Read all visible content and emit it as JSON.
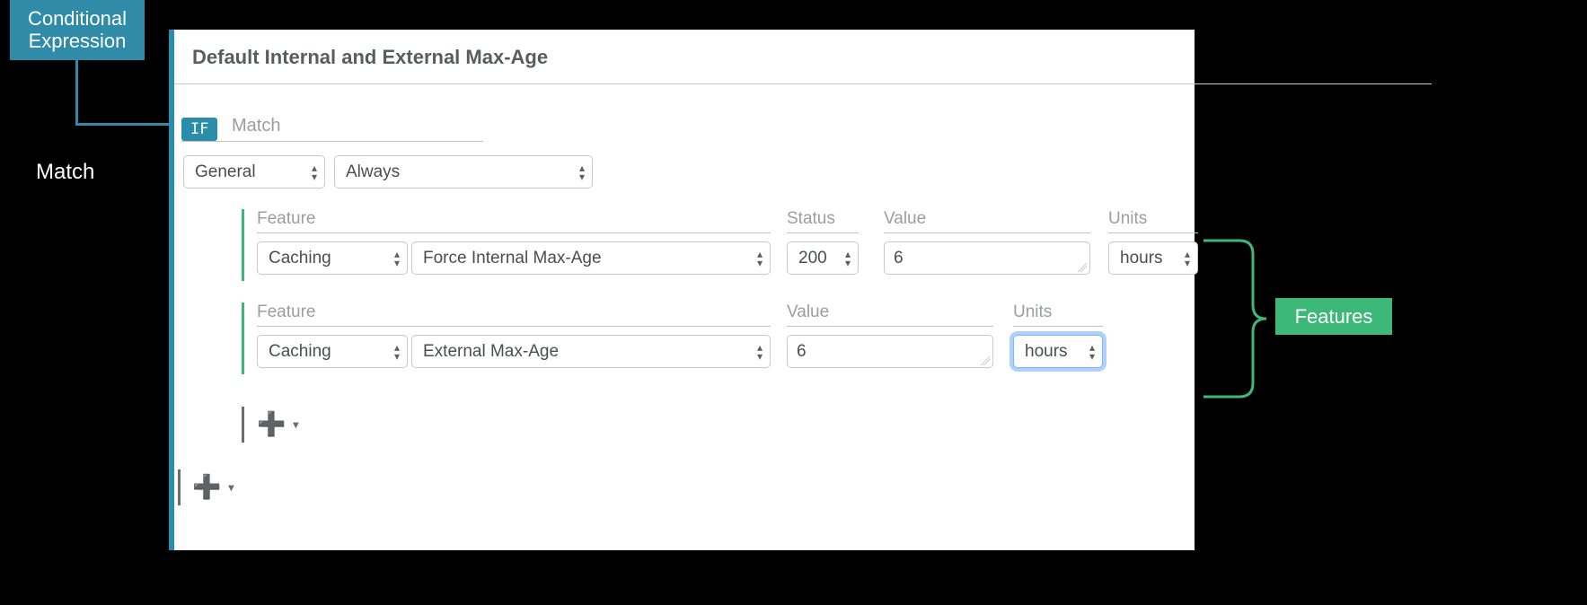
{
  "title": "Default Internal and External Max-Age",
  "if_badge": "IF",
  "match_header_label": "Match",
  "match": {
    "category": "General",
    "condition": "Always"
  },
  "features": [
    {
      "labels": {
        "feature": "Feature",
        "status": "Status",
        "value": "Value",
        "units": "Units"
      },
      "category": "Caching",
      "name": "Force Internal Max-Age",
      "status": "200",
      "value": "6",
      "units": "hours"
    },
    {
      "labels": {
        "feature": "Feature",
        "value": "Value",
        "units": "Units"
      },
      "category": "Caching",
      "name": "External Max-Age",
      "value": "6",
      "units": "hours"
    }
  ],
  "annotations": {
    "conditional_expression": "Conditional Expression",
    "match": "Match",
    "features": "Features"
  },
  "colors": {
    "teal": "#2f8ba7",
    "green": "#3cb878"
  }
}
